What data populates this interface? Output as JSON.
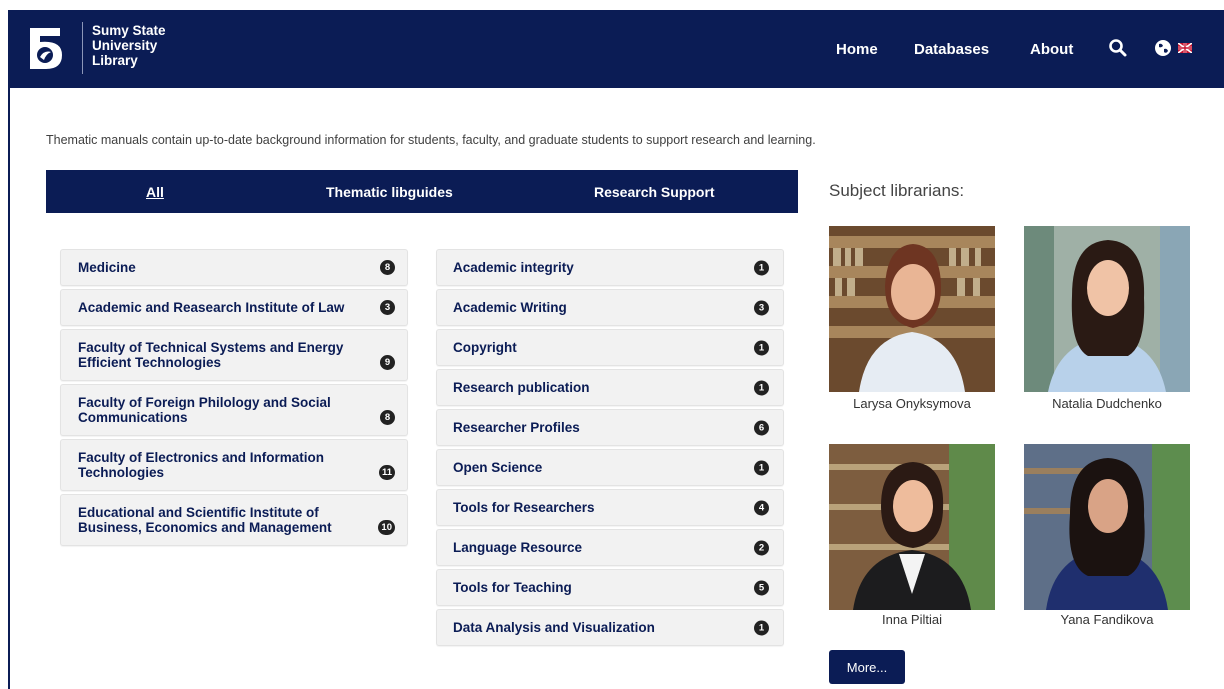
{
  "header": {
    "logo_icon": "library-logo",
    "logo_lines": [
      "Sumy State",
      "University",
      "Library"
    ],
    "nav": {
      "home": "Home",
      "databases": "Databases",
      "about": "About"
    },
    "icons": [
      "search-icon",
      "globe-icon",
      "uk-flag-icon"
    ],
    "color": "#0b1c55"
  },
  "intro": "Thematic manuals contain up-to-date background information for students, faculty, and graduate students to support research and learning.",
  "tabs": {
    "all": "All",
    "thematic": "Thematic libguides",
    "research": "Research Support"
  },
  "left_items": [
    {
      "label": "Medicine",
      "count": "8"
    },
    {
      "label": "Academic and Reasearch Institute of Law",
      "count": "3"
    },
    {
      "label": "Faculty of Technical Systems and Energy Efficient Technologies",
      "count": "9"
    },
    {
      "label": "Faculty of Foreign Philology and Social Communications",
      "count": "8"
    },
    {
      "label": "Faculty of Electronics and Information Technologies",
      "count": "11"
    },
    {
      "label": "Educational and Scientific Institute of Business, Economics and Management",
      "count": "10"
    }
  ],
  "right_items": [
    {
      "label": "Academic integrity",
      "count": "1"
    },
    {
      "label": "Academic Writing",
      "count": "3"
    },
    {
      "label": "Copyright",
      "count": "1"
    },
    {
      "label": "Research publication",
      "count": "1"
    },
    {
      "label": "Researcher Profiles",
      "count": "6"
    },
    {
      "label": "Open Science",
      "count": "1"
    },
    {
      "label": "Tools for Researchers",
      "count": "4"
    },
    {
      "label": "Language Resource",
      "count": "2"
    },
    {
      "label": "Tools for Teaching",
      "count": "5"
    },
    {
      "label": "Data Analysis and Visualization",
      "count": "1"
    }
  ],
  "librarians": {
    "title": "Subject librarians:",
    "people": [
      "Larysa Onyksymova",
      "Natalia Dudchenko",
      "Inna Piltiai",
      "Yana Fandikova"
    ],
    "more": "More..."
  }
}
